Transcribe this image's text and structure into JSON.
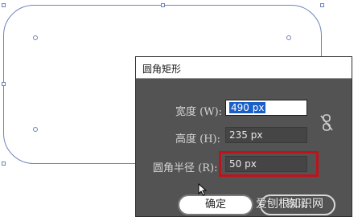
{
  "dialog": {
    "title": "圆角矩形",
    "width_label": "宽度 (W):",
    "width_value": "490 px",
    "height_label": "高度 (H):",
    "height_value": "235 px",
    "radius_label": "圆角半径 (R):",
    "radius_value": "50 px",
    "ok_label": "确定",
    "cancel_label": "取消"
  },
  "watermark": "爱刨根知识网",
  "colors": {
    "dialog_bg": "#535353",
    "shape_stroke": "#6f83b8",
    "highlight": "#c0121a",
    "selection": "#1a5fc8"
  },
  "icons": [
    "link-icon",
    "arrow-cursor-icon"
  ]
}
